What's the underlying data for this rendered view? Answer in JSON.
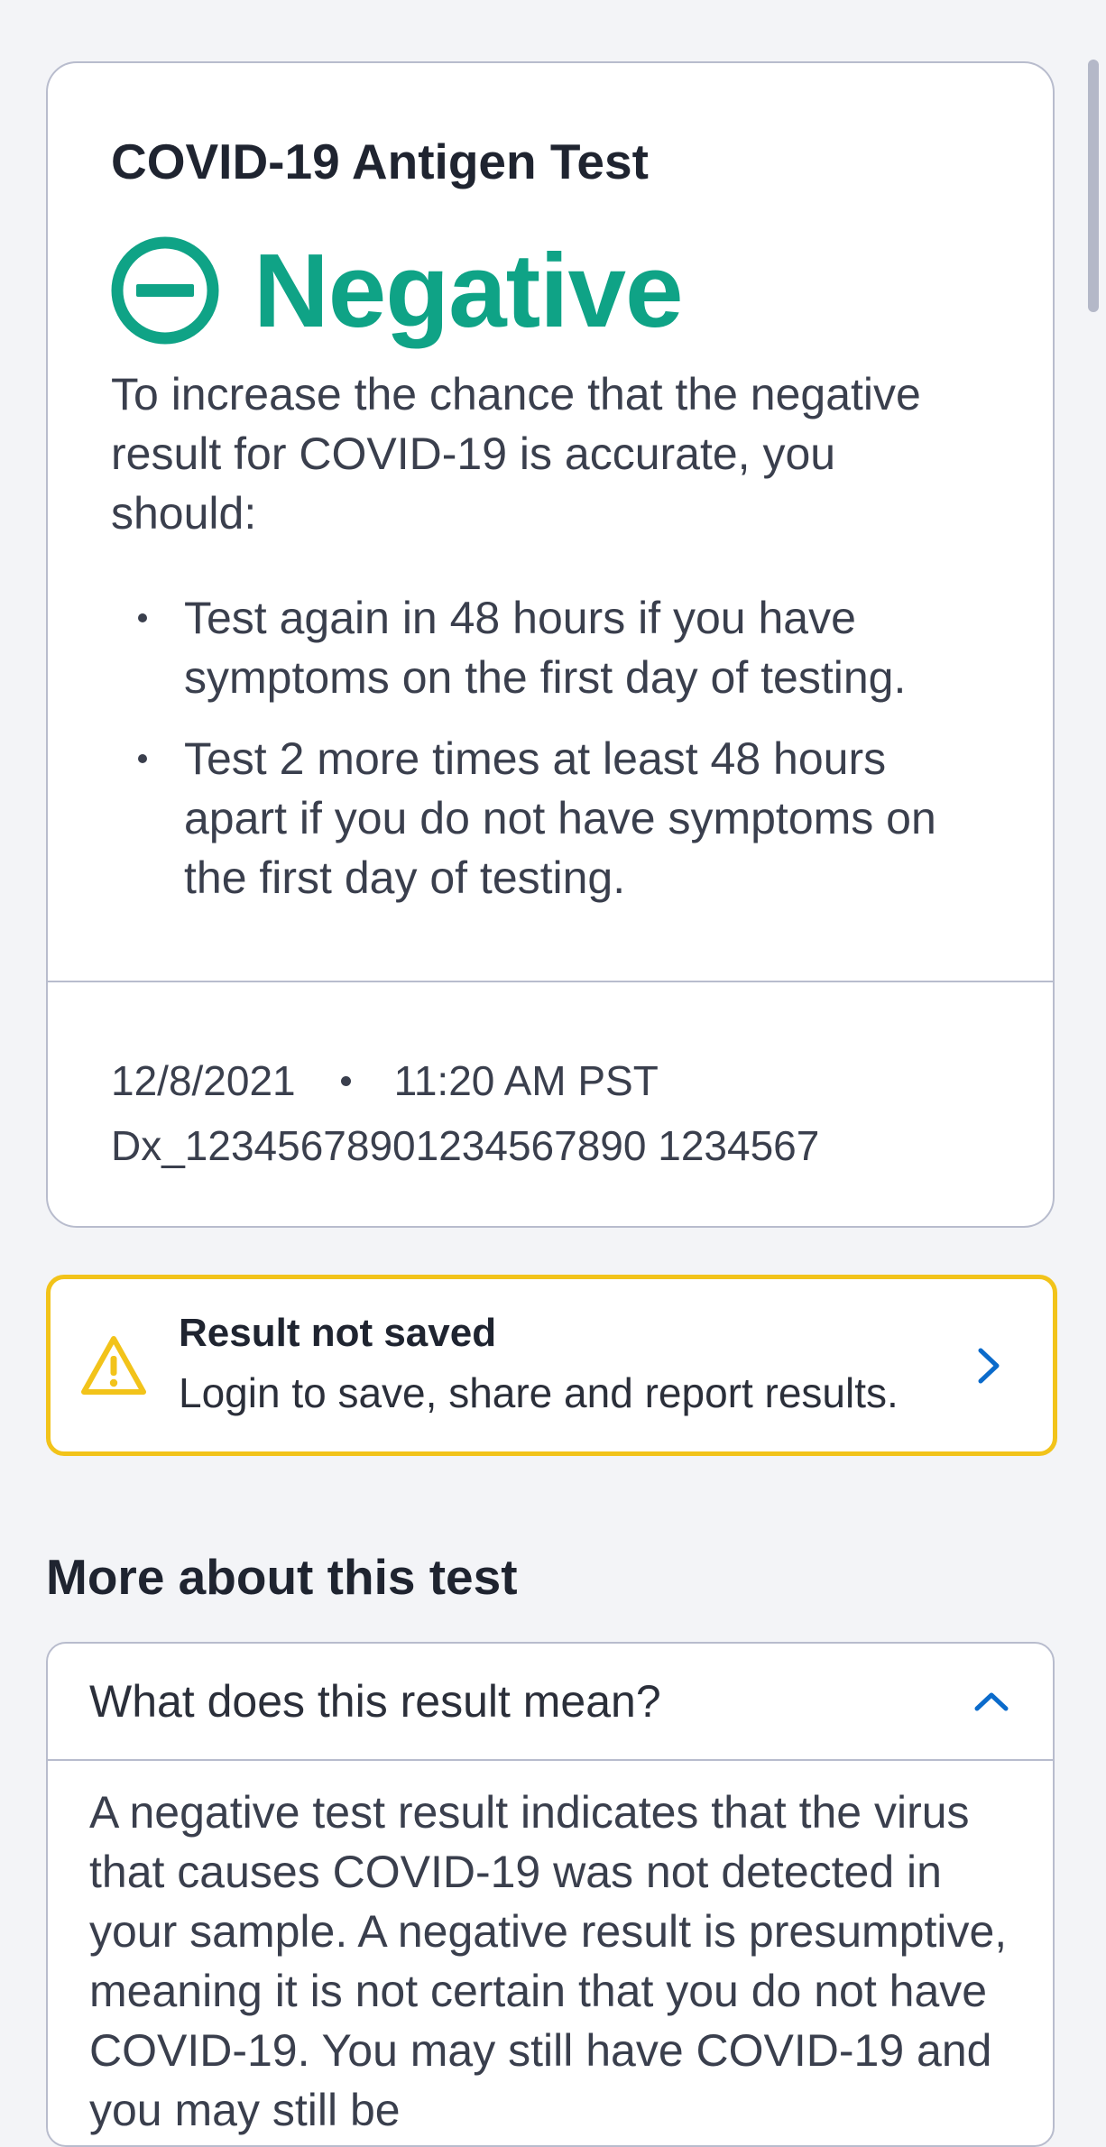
{
  "result_card": {
    "title": "COVID-19 Antigen Test",
    "result": "Negative",
    "result_icon": "minus-circle-icon",
    "result_color": "#0fa386",
    "advice": "To increase the chance that the negative result for COVID-19 is accurate, you should:",
    "bullets": [
      "Test again in 48 hours if you have symptoms on the first day of testing.",
      "Test 2 more times at least 48 hours apart if you do not have symptoms on the first day of testing."
    ],
    "date": "12/8/2021",
    "time": "11:20 AM PST",
    "test_id": "Dx_12345678901234567890 1234567"
  },
  "warning": {
    "icon": "warning-triangle-icon",
    "title": "Result not saved",
    "message": "Login to save, share and report results.",
    "border_color": "#f2c31a",
    "chevron": "chevron-right-icon"
  },
  "more": {
    "heading": "More about this test",
    "accordion": {
      "question": "What does this result mean?",
      "chevron": "chevron-up-icon",
      "answer": "A negative test result indicates that the virus that causes COVID-19 was not detected in your sample. A negative result is presumptive, meaning it is not certain that you do not have COVID-19. You may still have COVID-19 and you may still be"
    }
  },
  "accent_color": "#0b6bcb"
}
